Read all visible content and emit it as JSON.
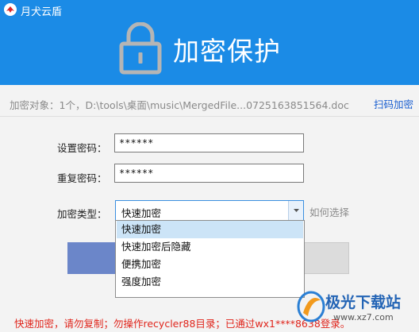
{
  "window": {
    "title": "月犬云盾"
  },
  "hero": {
    "title": "加密保护"
  },
  "target": {
    "label": "加密对象：1个，D:\\tools\\桌面\\music\\MergedFile...0725163851564.doc",
    "scan_link": "扫码加密"
  },
  "form": {
    "password_label": "设置密码：",
    "password_value": "******",
    "repeat_label": "重复密码：",
    "repeat_value": "******",
    "type_label": "加密类型：",
    "type_selected": "快速加密",
    "how_link": "如何选择"
  },
  "dropdown": {
    "options": [
      "快速加密",
      "快速加密后隐藏",
      "便携加密",
      "强度加密"
    ]
  },
  "footer": {
    "notice": "快速加密，请勿复制；勿操作recycler88目录；已通过wx1****8638登录。"
  },
  "watermark": {
    "text": "极光下载站",
    "url": "www.xz7.com"
  },
  "colors": {
    "header": "#1b8be6",
    "notice": "#e0241b",
    "link": "#1a5fd0",
    "selected_option": "#cce4f7"
  }
}
